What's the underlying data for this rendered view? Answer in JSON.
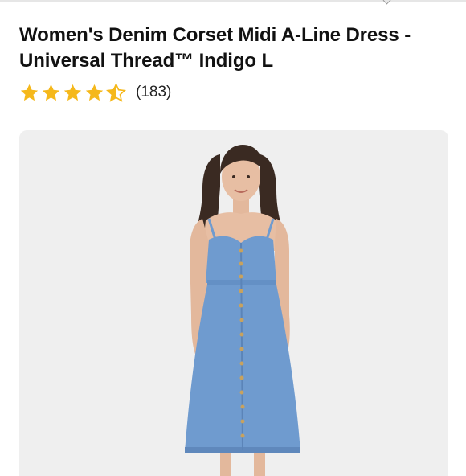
{
  "product": {
    "title": "Women's Denim Corset Midi A-Line Dress - Universal Thread™ Indigo L",
    "rating": {
      "value": 4.5,
      "max": 5,
      "review_count_label": "(183)",
      "star_color": "#f5b81b",
      "star_empty_color": "#d9d9d9"
    },
    "image": {
      "alt": "Woman wearing a button-front denim midi dress",
      "background_color": "#efefef",
      "dress_color": "#6f9bcf"
    }
  }
}
